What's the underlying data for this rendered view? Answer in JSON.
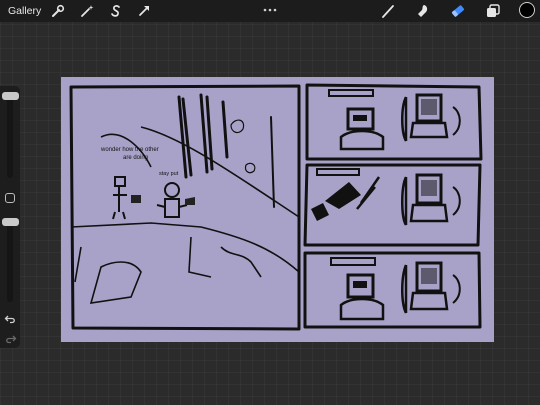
{
  "topbar": {
    "gallery_label": "Gallery",
    "left_tools": [
      "wrench-icon",
      "magic-wand-icon",
      "selection-s-icon",
      "transform-arrow-icon"
    ],
    "right_tools": [
      "brush-icon",
      "smudge-icon",
      "eraser-icon",
      "layers-icon"
    ],
    "active_tool": "eraser-icon",
    "current_color": "#000000",
    "accent_color": "#3d8bff"
  },
  "sidebar": {
    "icons": [
      "modify-square-icon",
      "undo-icon",
      "redo-icon"
    ]
  },
  "canvas": {
    "background_color": "#a9a2c8",
    "sketch_text_line1": "wonder how the other",
    "sketch_text_line2": "are doing",
    "sketch_label": "stay put"
  }
}
